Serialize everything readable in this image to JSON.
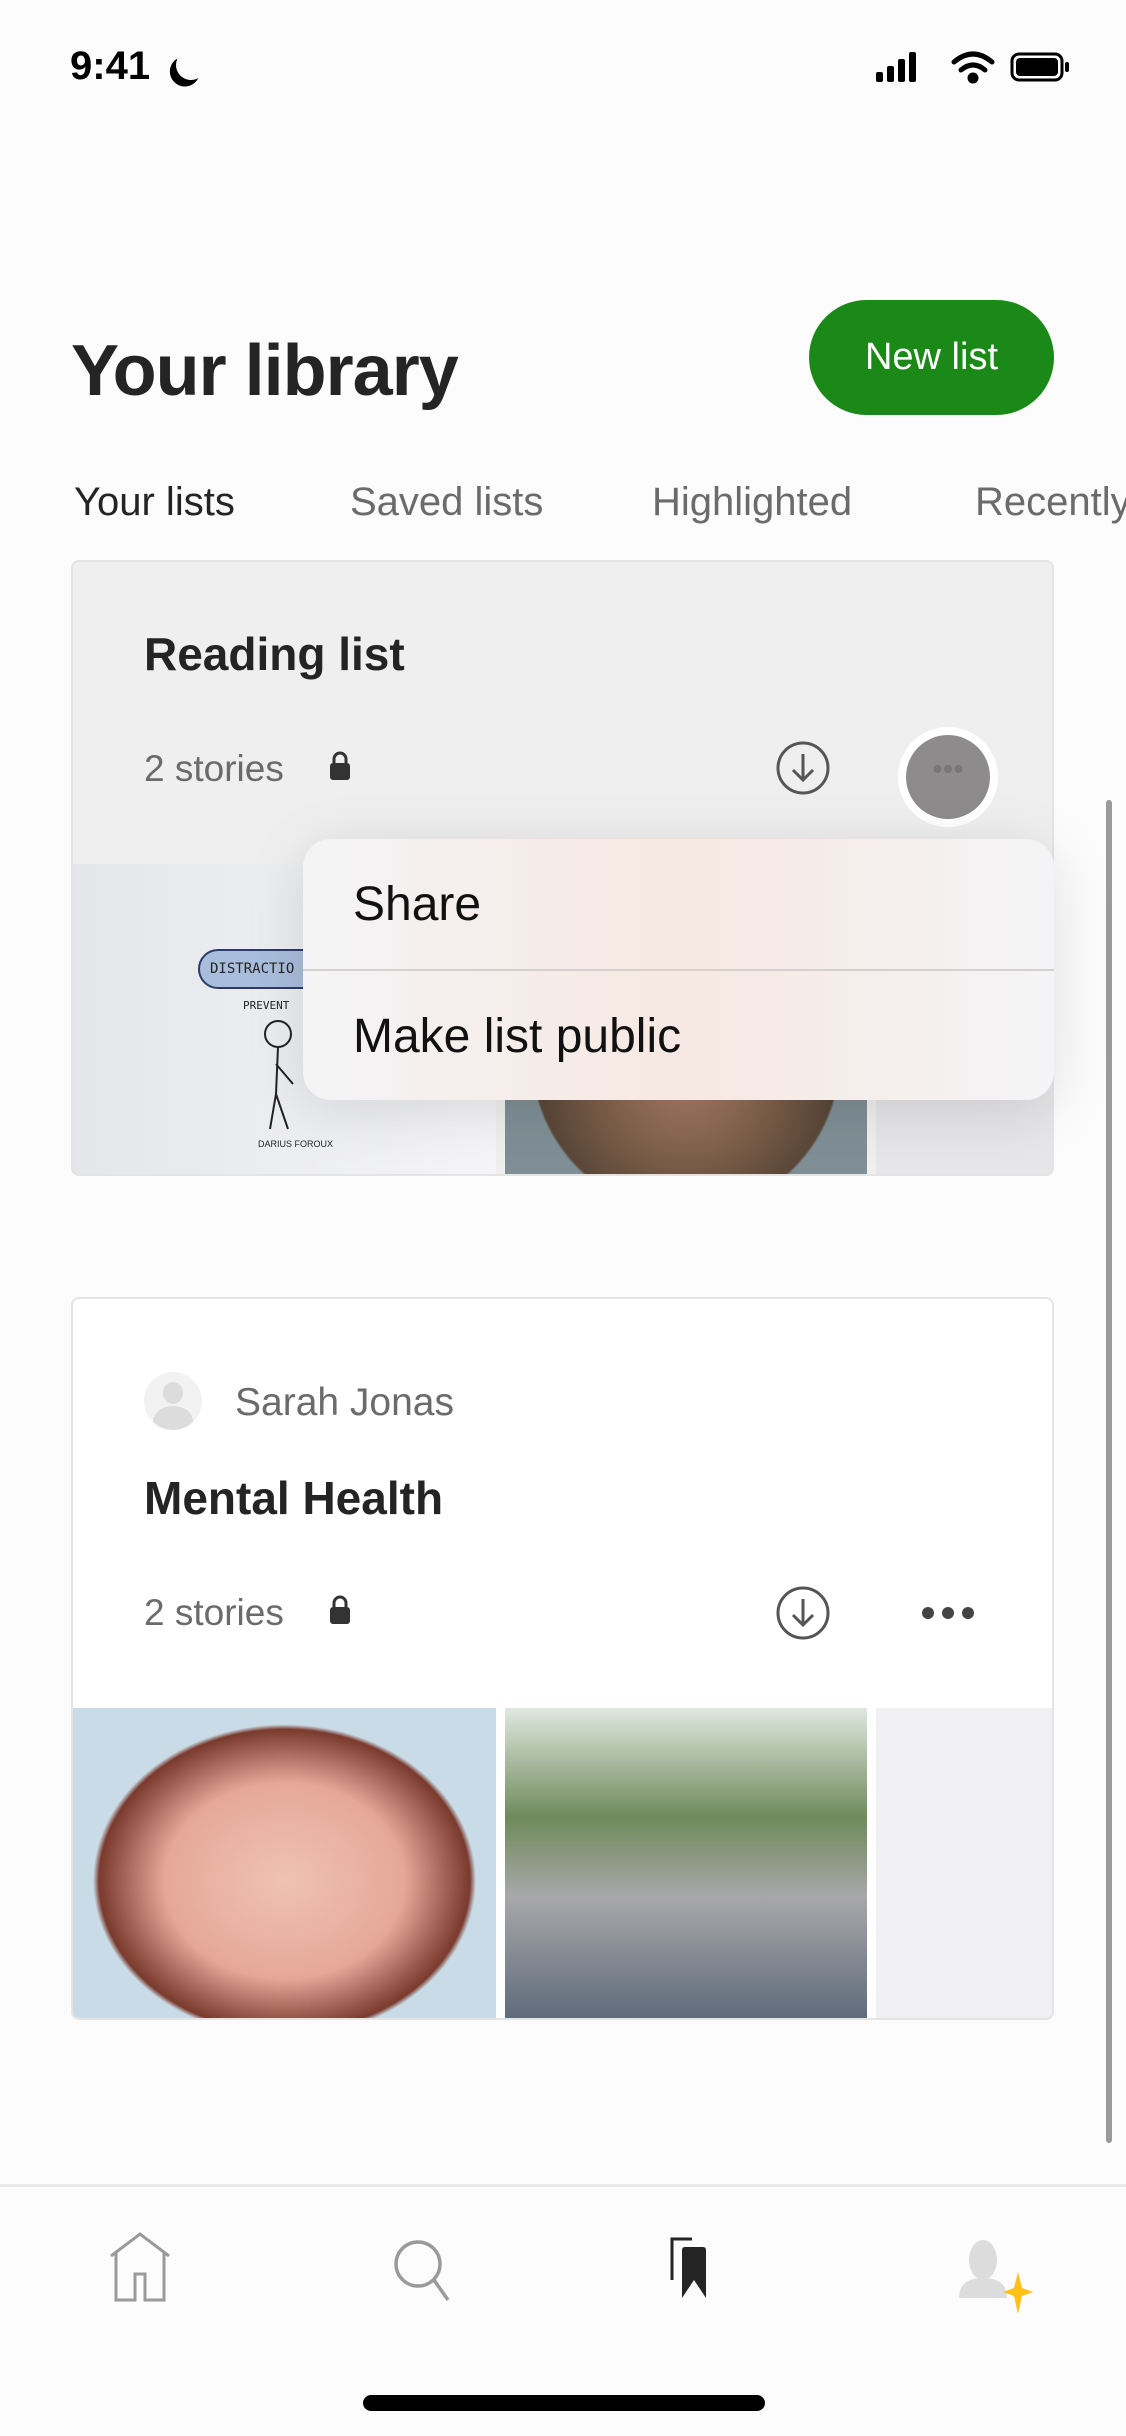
{
  "status_bar": {
    "time": "9:41",
    "icons": [
      "moon-icon",
      "signal-icon",
      "wifi-icon",
      "battery-icon"
    ]
  },
  "header": {
    "title": "Your library",
    "new_list_label": "New list"
  },
  "tabs": [
    {
      "label": "Your lists",
      "active": true
    },
    {
      "label": "Saved lists"
    },
    {
      "label": "Highlighted"
    },
    {
      "label": "Recently"
    }
  ],
  "lists": [
    {
      "title": "Reading list",
      "stories": "2 stories",
      "private": true,
      "image_texts": [
        "DISTRACTIO",
        "PREVENT",
        "DARIUS FOROUX"
      ]
    },
    {
      "author": "Sarah Jonas",
      "title": "Mental Health",
      "stories": "2 stories",
      "private": true
    }
  ],
  "context_menu": {
    "items": [
      "Share",
      "Make list public"
    ]
  },
  "bottom_nav": [
    {
      "icon": "home-icon"
    },
    {
      "icon": "search-icon"
    },
    {
      "icon": "bookmarks-icon",
      "active": true
    },
    {
      "icon": "profile-icon"
    }
  ],
  "colors": {
    "accent": "#1a8917",
    "text": "#242424",
    "muted": "#6b6b6b",
    "sparkle": "#ffc017"
  }
}
